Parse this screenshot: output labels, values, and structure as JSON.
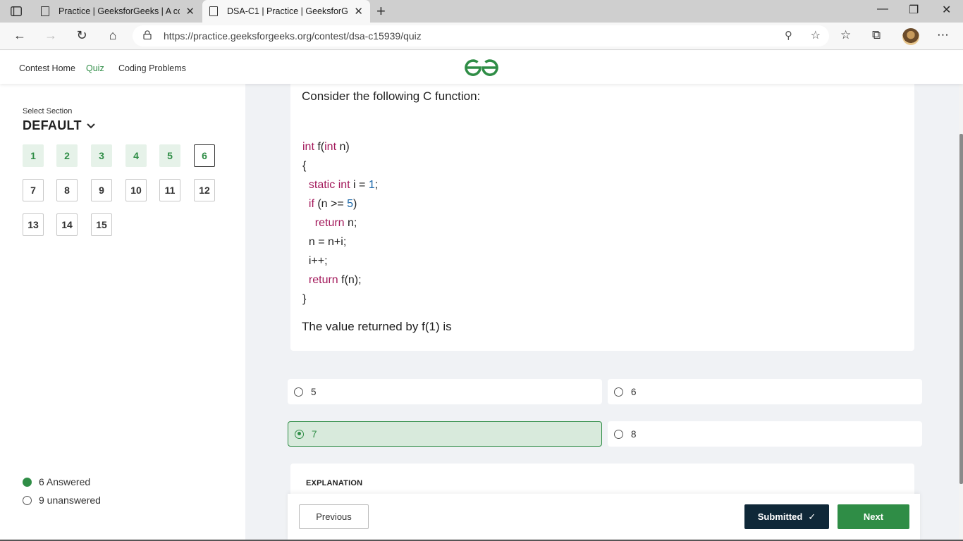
{
  "browser": {
    "tabs": [
      {
        "title": "Practice | GeeksforGeeks | A com",
        "active": false
      },
      {
        "title": "DSA-C1 | Practice | GeeksforGeel",
        "active": true
      }
    ],
    "url": "https://practice.geeksforgeeks.org/contest/dsa-c15939/quiz"
  },
  "site": {
    "nav": [
      "Contest Home",
      "Quiz",
      "Coding Problems"
    ],
    "active_nav": "Quiz",
    "brand_color": "#2f8d46"
  },
  "sidebar": {
    "select_label": "Select Section",
    "section": "DEFAULT",
    "questions": [
      "1",
      "2",
      "3",
      "4",
      "5",
      "6",
      "7",
      "8",
      "9",
      "10",
      "11",
      "12",
      "13",
      "14",
      "15"
    ],
    "answered_count_label": "6 Answered",
    "unanswered_count_label": "9 unanswered"
  },
  "question": {
    "intro": "Consider the following C function:",
    "code_lines": [
      "int f(int n)",
      "{",
      "  static int i = 1;",
      "  if (n >= 5)",
      "    return n;",
      "  n = n+i;",
      "  i++;",
      "  return f(n);",
      "}"
    ],
    "prompt": "The value returned by f(1) is"
  },
  "options": [
    "5",
    "6",
    "7",
    "8"
  ],
  "selected_option": "7",
  "explanation_title": "EXPLANATION",
  "footer": {
    "previous": "Previous",
    "submitted": "Submitted",
    "next": "Next"
  }
}
